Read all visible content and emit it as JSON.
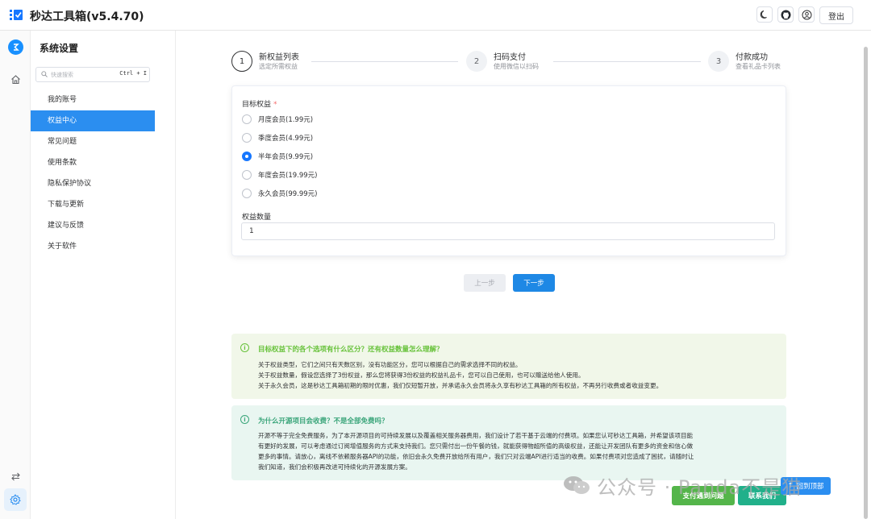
{
  "app": {
    "title": "秒达工具箱(v5.4.70)",
    "logout_label": "登出",
    "accent_color": "#1890ff"
  },
  "titlebar_icons": [
    "moon-icon",
    "github-icon",
    "user-icon"
  ],
  "sidebar": {
    "title": "系统设置",
    "search": {
      "placeholder": "快速搜索",
      "shortcut": "Ctrl + I"
    },
    "items": [
      {
        "label": "我的账号",
        "active": false
      },
      {
        "label": "权益中心",
        "active": true
      },
      {
        "label": "常见问题",
        "active": false
      },
      {
        "label": "使用条款",
        "active": false
      },
      {
        "label": "隐私保护协议",
        "active": false
      },
      {
        "label": "下载与更新",
        "active": false
      },
      {
        "label": "建议与反馈",
        "active": false
      },
      {
        "label": "关于软件",
        "active": false
      }
    ]
  },
  "steps": [
    {
      "number": "1",
      "title": "新权益列表",
      "desc": "选定所需权益",
      "active": true
    },
    {
      "number": "2",
      "title": "扫码支付",
      "desc": "使用微信以扫码",
      "active": false
    },
    {
      "number": "3",
      "title": "付款成功",
      "desc": "查看礼品卡列表",
      "active": false
    }
  ],
  "form": {
    "target_label": "目标权益",
    "required_mark": "*",
    "options": [
      {
        "label": "月度会员(1.99元)",
        "checked": false
      },
      {
        "label": "季度会员(4.99元)",
        "checked": false
      },
      {
        "label": "半年会员(9.99元)",
        "checked": true
      },
      {
        "label": "年度会员(19.99元)",
        "checked": false
      },
      {
        "label": "永久会员(99.99元)",
        "checked": false
      }
    ],
    "quantity_label": "权益数量",
    "quantity_value": "1",
    "prev_label": "上一步",
    "next_label": "下一步"
  },
  "info1": {
    "icon": "info-icon",
    "title": "目标权益下的各个选项有什么区分？还有权益数量怎么理解？",
    "lines": [
      "关于权益类型，它们之间只有天数区别，没有功能区分，您可以根据自己的需求选择不同的权益。",
      "关于权益数量，假设您选择了3份权益，那么您将获得3份权益的权益礼品卡，您可以自己使用，也可以赠送给他人使用。",
      "关于永久会员，这是秒达工具箱初期的限时优惠，我们仅短暂开放，并承诺永久会员将永久享有秒达工具箱的所有权益，不再另行收费或者收益变更。"
    ]
  },
  "info2": {
    "icon": "info-icon",
    "title": "为什么开源项目会收费？不是全部免费吗？",
    "lines": [
      "开源不等于完全免费服务，为了本开源项目的可持续发展以及覆盖相关服务器费用，我们设计了若干基于云端的付费项。如果您认可秒达工具箱，并希望该项目能",
      "有更好的发展，可以考虑通过订阅增值服务的方式来支持我们。您只需付出一份午餐的钱，就能获得物超所值的高级权益，还能让开发团队有更多的资金和信心做",
      "更多的事情。请放心，离线不依赖服务器API的功能，依旧会永久免费开放给所有用户，我们只对云端API进行适当的收费。如果付费项对您造成了困扰，请随时让",
      "我们知道，我们会积极再改进可持续化的开源发展方案。"
    ]
  },
  "bottom": {
    "pay_issue_label": "支付遇到问题",
    "contact_label": "联系我们",
    "back_top_label": "回到顶部"
  },
  "watermark": {
    "text": "公众号 · Panda不是猫"
  }
}
